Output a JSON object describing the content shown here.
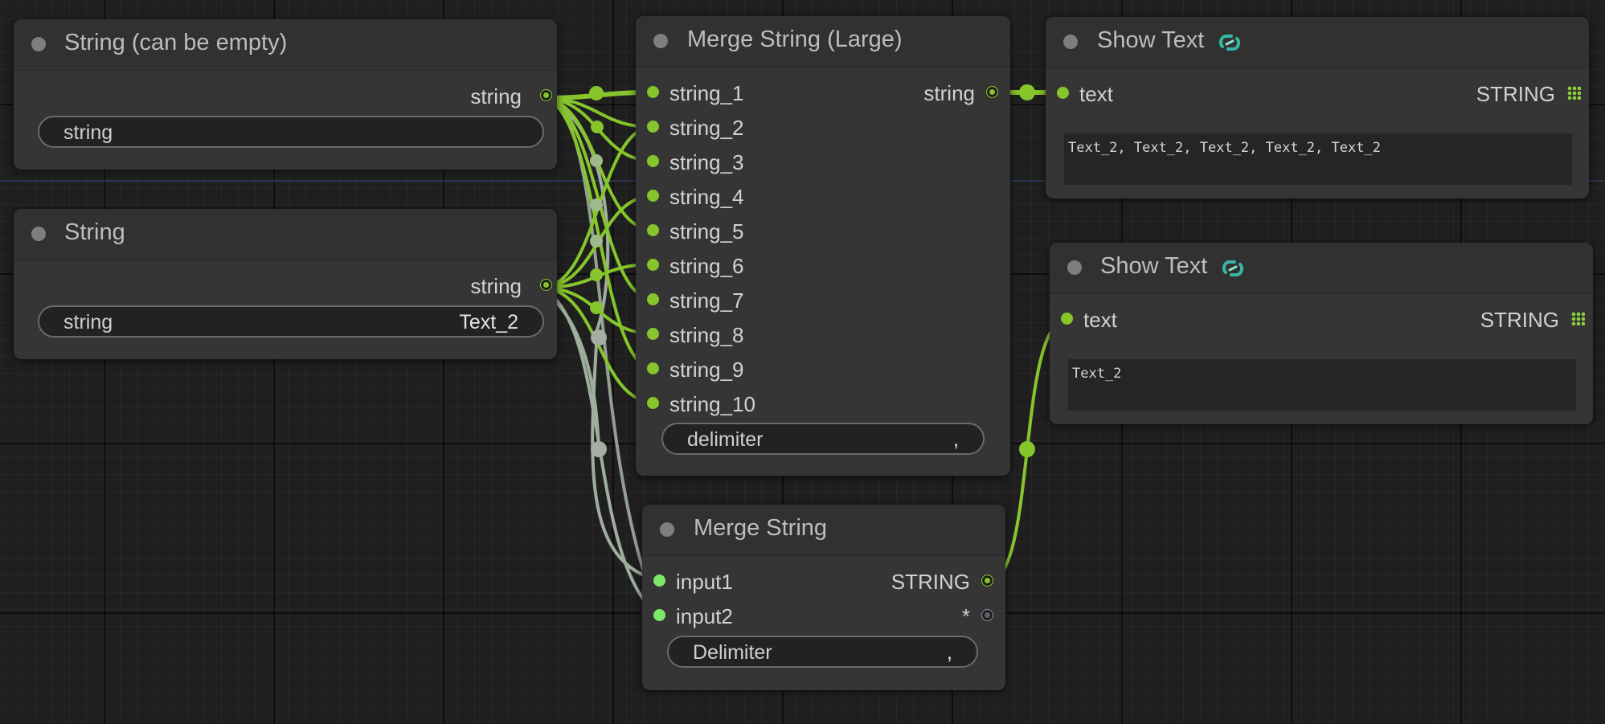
{
  "nodes": {
    "string_empty": {
      "title": "String (can be empty)",
      "output_label": "string",
      "widget_label": "string",
      "widget_value": ""
    },
    "string": {
      "title": "String",
      "output_label": "string",
      "widget_label": "string",
      "widget_value": "Text_2"
    },
    "merge_large": {
      "title": "Merge String (Large)",
      "inputs": [
        "string_1",
        "string_2",
        "string_3",
        "string_4",
        "string_5",
        "string_6",
        "string_7",
        "string_8",
        "string_9",
        "string_10"
      ],
      "output_label": "string",
      "widget_label": "delimiter",
      "widget_value": ","
    },
    "merge": {
      "title": "Merge String",
      "inputs": [
        "input1",
        "input2"
      ],
      "output_label": "STRING",
      "output2_label": "*",
      "widget_label": "Delimiter",
      "widget_value": ","
    },
    "show_text_1": {
      "title": "Show Text",
      "input_label": "text",
      "output_label": "STRING",
      "text": "Text_2, Text_2, Text_2, Text_2, Text_2"
    },
    "show_text_2": {
      "title": "Show Text",
      "input_label": "text",
      "output_label": "STRING",
      "text": "Text_2"
    }
  },
  "colors": {
    "canvas": "#1f1f1f",
    "node_body": "#353535",
    "string_wire": "#86c52c",
    "grey_wire": "#9aa89a",
    "icon_teal": "#35b7a4"
  },
  "icons": {
    "node_status": "circle-dot-icon",
    "show_text": "link-chain-icon",
    "output_list": "grid-dots-icon"
  }
}
